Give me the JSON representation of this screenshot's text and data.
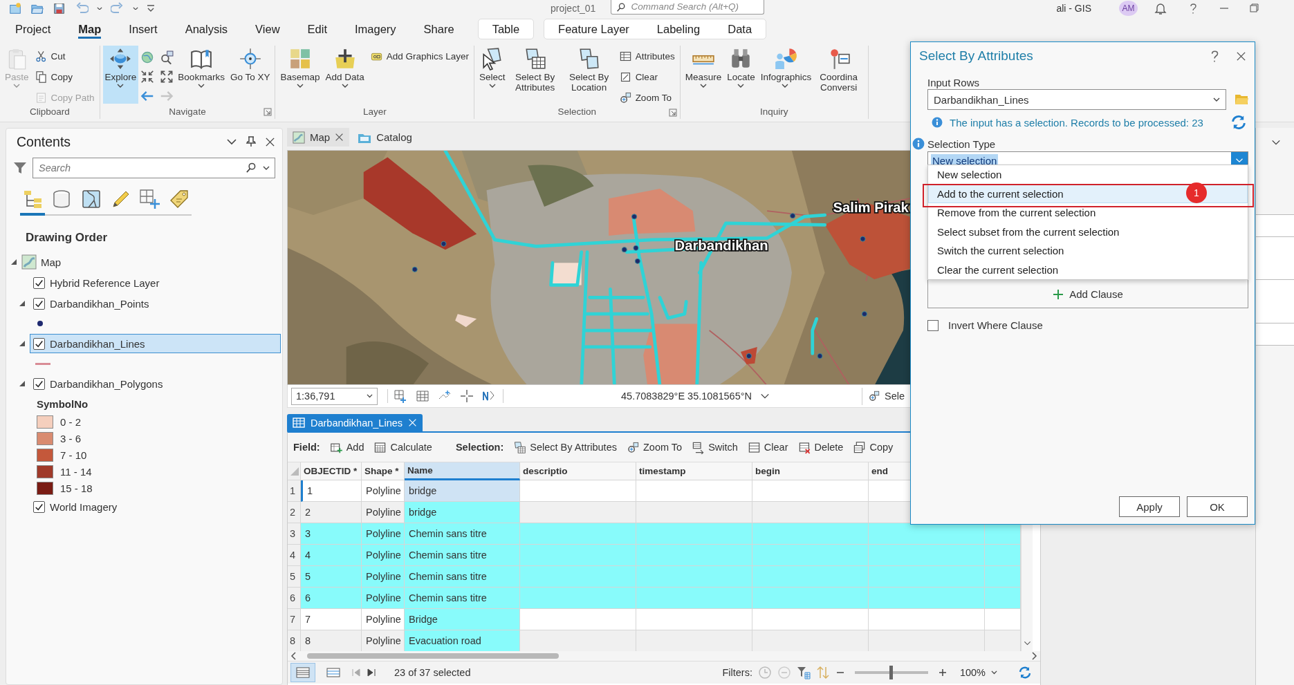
{
  "title_bar": {
    "project": "project_01",
    "search_placeholder": "Command Search (Alt+Q)",
    "user": "ali - GIS",
    "avatar_initials": "AM"
  },
  "ribbon_tabs": [
    {
      "label": "Project",
      "selected": false
    },
    {
      "label": "Map",
      "selected": true
    },
    {
      "label": "Insert",
      "selected": false
    },
    {
      "label": "Analysis",
      "selected": false
    },
    {
      "label": "View",
      "selected": false
    },
    {
      "label": "Edit",
      "selected": false
    },
    {
      "label": "Imagery",
      "selected": false
    },
    {
      "label": "Share",
      "selected": false
    }
  ],
  "contextual_tab_groups": [
    {
      "tabs": [
        {
          "label": "Table",
          "selected": false
        }
      ]
    },
    {
      "tabs": [
        {
          "label": "Feature Layer",
          "selected": false
        },
        {
          "label": "Labeling",
          "selected": false
        },
        {
          "label": "Data",
          "selected": false
        }
      ]
    }
  ],
  "ribbon_groups": [
    {
      "label": "Clipboard",
      "launcher": false,
      "buttons": [
        {
          "kind": "large",
          "label": "Paste",
          "dropdown": true,
          "disabled": true,
          "active": false
        },
        {
          "kind": "small",
          "label": "Cut",
          "disabled": false,
          "active": false
        },
        {
          "kind": "small",
          "label": "Copy",
          "disabled": false,
          "active": false
        },
        {
          "kind": "small",
          "label": "Copy Path",
          "disabled": true,
          "active": false
        }
      ]
    },
    {
      "label": "Navigate",
      "launcher": true,
      "buttons": [
        {
          "kind": "large",
          "label": "Explore",
          "dropdown": true,
          "disabled": false,
          "active": true
        },
        {
          "kind": "icon",
          "disabled": false,
          "active": false
        },
        {
          "kind": "icon",
          "disabled": false,
          "active": false
        },
        {
          "kind": "icon",
          "disabled": false,
          "active": false
        },
        {
          "kind": "icon",
          "disabled": false,
          "active": false
        },
        {
          "kind": "icon",
          "disabled": false,
          "active": false
        },
        {
          "kind": "icon",
          "disabled": true,
          "active": false
        },
        {
          "kind": "large",
          "label": "Bookmarks",
          "dropdown": true,
          "disabled": false,
          "active": false
        },
        {
          "kind": "large",
          "label": "Go To XY",
          "dropdown": false,
          "disabled": false,
          "active": false
        }
      ]
    },
    {
      "label": "Layer",
      "launcher": false,
      "buttons": [
        {
          "kind": "large",
          "label": "Basemap",
          "dropdown": true,
          "disabled": false,
          "active": false
        },
        {
          "kind": "large",
          "label": "Add Data",
          "dropdown": true,
          "disabled": false,
          "active": false
        },
        {
          "kind": "small",
          "label": "Add Graphics Layer",
          "disabled": false,
          "active": false
        }
      ]
    },
    {
      "label": "Selection",
      "launcher": true,
      "buttons": [
        {
          "kind": "large",
          "label": "Select",
          "dropdown": true,
          "disabled": false,
          "active": false
        },
        {
          "kind": "large",
          "label": "Select By Attributes",
          "dropdown": false,
          "disabled": false,
          "active": false
        },
        {
          "kind": "large",
          "label": "Select By Location",
          "dropdown": false,
          "disabled": false,
          "active": false
        },
        {
          "kind": "small",
          "label": "Attributes",
          "disabled": false,
          "active": false
        },
        {
          "kind": "small",
          "label": "Clear",
          "disabled": false,
          "active": false
        },
        {
          "kind": "small",
          "label": "Zoom To",
          "disabled": false,
          "active": false
        }
      ]
    },
    {
      "label": "Inquiry",
      "launcher": false,
      "buttons": [
        {
          "kind": "large",
          "label": "Measure",
          "dropdown": true,
          "disabled": false,
          "active": false
        },
        {
          "kind": "large",
          "label": "Locate",
          "dropdown": true,
          "disabled": false,
          "active": false
        },
        {
          "kind": "large",
          "label": "Infographics",
          "dropdown": true,
          "disabled": false,
          "active": false
        },
        {
          "kind": "large",
          "label": "Coordina Conversi",
          "dropdown": false,
          "disabled": false,
          "active": false
        }
      ]
    }
  ],
  "contents": {
    "title": "Contents",
    "search_placeholder": "Search",
    "view_tabs": [
      {
        "selected": true
      },
      {
        "selected": false
      },
      {
        "selected": false
      },
      {
        "selected": false
      },
      {
        "selected": false
      },
      {
        "selected": false
      }
    ],
    "heading": "Drawing Order",
    "tree": [
      {
        "kind": "map",
        "label": "Map",
        "expanded": true,
        "children": [
          {
            "kind": "layer",
            "label": "Hybrid Reference Layer",
            "checked": true,
            "selected": false
          },
          {
            "kind": "layer",
            "label": "Darbandikhan_Points",
            "checked": true,
            "selected": false,
            "expanded": true,
            "legend": [
              {
                "kind": "point",
                "color": "#1f2a70"
              }
            ]
          },
          {
            "kind": "layer",
            "label": "Darbandikhan_Lines",
            "checked": true,
            "selected": true,
            "expanded": true,
            "legend": [
              {
                "kind": "line",
                "color": "#d98c96"
              }
            ]
          },
          {
            "kind": "layer",
            "label": "Darbandikhan_Polygons",
            "checked": true,
            "selected": false,
            "expanded": true,
            "legend_title": "SymbolNo",
            "legend": [
              {
                "kind": "fill",
                "label": "0 - 2",
                "color": "#f5cfbd"
              },
              {
                "kind": "fill",
                "label": "3 - 6",
                "color": "#d98b70"
              },
              {
                "kind": "fill",
                "label": "7 - 10",
                "color": "#c4583b"
              },
              {
                "kind": "fill",
                "label": "11 - 14",
                "color": "#a03a2a"
              },
              {
                "kind": "fill",
                "label": "15 - 18",
                "color": "#7a1c14"
              }
            ]
          },
          {
            "kind": "layer",
            "label": "World Imagery",
            "checked": true,
            "selected": false
          }
        ]
      }
    ]
  },
  "map_view": {
    "tabs": [
      {
        "label": "Map",
        "selected": true,
        "closable": true
      },
      {
        "label": "Catalog",
        "selected": false,
        "closable": false
      }
    ],
    "labels": [
      "Salim Pirak",
      "Darbandikhan"
    ],
    "scale": "1:36,791",
    "coordinates": "45.7083829°E 35.1081565°N",
    "select_tool": "Sele"
  },
  "attribute_table": {
    "tab": {
      "label": "Darbandikhan_Lines",
      "selected": true
    },
    "toolbar": {
      "field_label": "Field:",
      "field_buttons": [
        "Add",
        "Calculate"
      ],
      "selection_label": "Selection:",
      "selection_buttons": [
        "Select By Attributes",
        "Zoom To",
        "Switch",
        "Clear",
        "Delete",
        "Copy"
      ]
    },
    "columns": [
      {
        "label": "OBJECTID *",
        "selected": false
      },
      {
        "label": "Shape *",
        "selected": false
      },
      {
        "label": "Name",
        "selected": true
      },
      {
        "label": "descriptio",
        "selected": false
      },
      {
        "label": "timestamp",
        "selected": false
      },
      {
        "label": "begin",
        "selected": false
      },
      {
        "label": "end",
        "selected": false
      }
    ],
    "rows": [
      {
        "row_number": "1",
        "values": [
          "1",
          "Polyline",
          "bridge"
        ],
        "current": true,
        "selected": false,
        "name_highlighted": false
      },
      {
        "row_number": "2",
        "values": [
          "2",
          "Polyline",
          "bridge"
        ],
        "current": false,
        "selected": false,
        "name_highlighted": true
      },
      {
        "row_number": "3",
        "values": [
          "3",
          "Polyline",
          "Chemin sans titre"
        ],
        "current": false,
        "selected": true,
        "name_highlighted": true
      },
      {
        "row_number": "4",
        "values": [
          "4",
          "Polyline",
          "Chemin sans titre"
        ],
        "current": false,
        "selected": true,
        "name_highlighted": true
      },
      {
        "row_number": "5",
        "values": [
          "5",
          "Polyline",
          "Chemin sans titre"
        ],
        "current": false,
        "selected": true,
        "name_highlighted": true
      },
      {
        "row_number": "6",
        "values": [
          "6",
          "Polyline",
          "Chemin sans titre"
        ],
        "current": false,
        "selected": true,
        "name_highlighted": true
      },
      {
        "row_number": "7",
        "values": [
          "7",
          "Polyline",
          "Bridge"
        ],
        "current": false,
        "selected": false,
        "name_highlighted": true
      },
      {
        "row_number": "8",
        "values": [
          "8",
          "Polyline",
          "Evacuation road"
        ],
        "current": false,
        "selected": false,
        "name_highlighted": true
      }
    ],
    "status": {
      "view_modes": [
        {
          "selected": true
        },
        {
          "selected": false
        }
      ],
      "record_count": "23 of 37 selected",
      "filters_label": "Filters:",
      "zoom": {
        "level": 0.49,
        "reading": "100%"
      }
    }
  },
  "dialog": {
    "title": "Select By Attributes",
    "input_rows_label": "Input Rows",
    "input_rows": "Darbandikhan_Lines",
    "message": "The input has a selection. Records to be processed: 23",
    "selection_type_label": "Selection Type",
    "selection_type": {
      "value": "New selection",
      "expanded": true,
      "options": [
        {
          "label": "New selection",
          "highlighted": false
        },
        {
          "label": "Add to the current selection",
          "highlighted": true
        },
        {
          "label": "Remove from the current selection",
          "highlighted": false
        },
        {
          "label": "Select subset from the current selection",
          "highlighted": false
        },
        {
          "label": "Switch the current selection",
          "highlighted": false
        },
        {
          "label": "Clear the current selection",
          "highlighted": false
        }
      ]
    },
    "add_clause": "Add Clause",
    "invert": {
      "label": "Invert Where Clause",
      "checked": false
    },
    "buttons": [
      "Apply",
      "OK"
    ],
    "annotation": {
      "number": "1"
    }
  }
}
